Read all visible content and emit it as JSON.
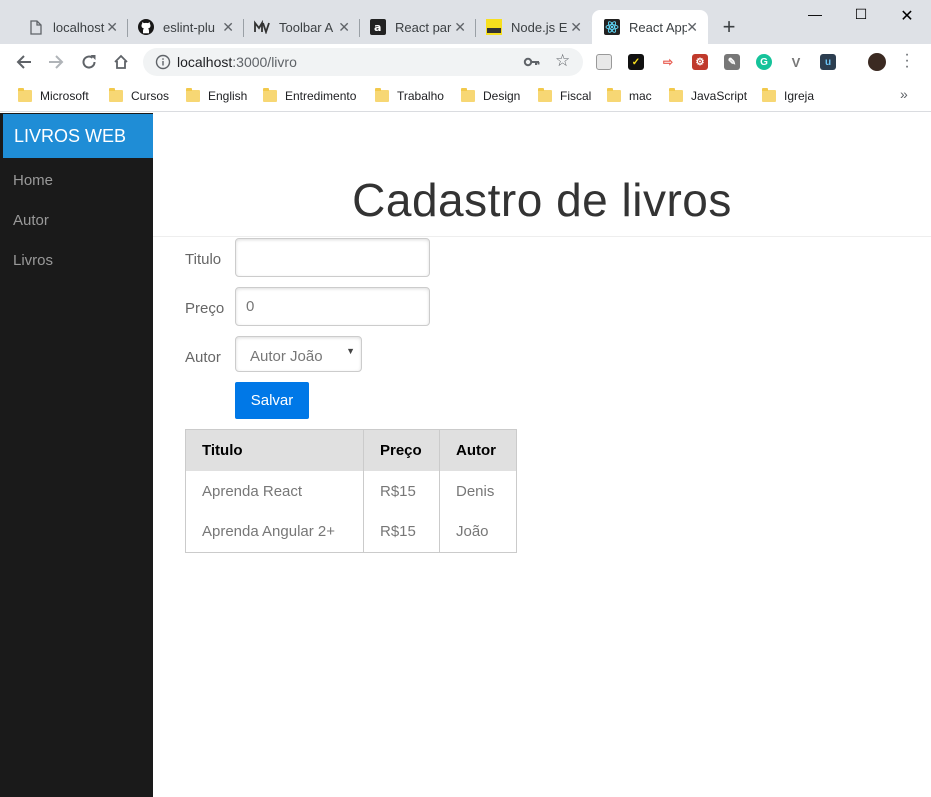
{
  "browser": {
    "tabs": [
      {
        "title": "localhost",
        "icon": "page-icon",
        "active": false
      },
      {
        "title": "eslint-plu",
        "icon": "github-icon",
        "active": false
      },
      {
        "title": "Toolbar A",
        "icon": "toolbar-icon",
        "active": false
      },
      {
        "title": "React par",
        "icon": "a-icon",
        "active": false
      },
      {
        "title": "Node.js E",
        "icon": "node-icon",
        "active": false
      },
      {
        "title": "React App",
        "icon": "react-icon",
        "active": true
      }
    ],
    "new_tab": "+",
    "address": {
      "host": "localhost",
      "path": ":3000/livro"
    },
    "bookmarks": [
      "Microsoft",
      "Cursos",
      "English",
      "Entredimento",
      "Trabalho",
      "Design",
      "Fiscal",
      "mac",
      "JavaScript",
      "Igreja"
    ],
    "bookmarks_more": "»",
    "colors": {
      "titlebar": "#dee1e6"
    }
  },
  "sidebar": {
    "brand": "LIVROS WEB",
    "items": [
      {
        "label": "Home"
      },
      {
        "label": "Autor"
      },
      {
        "label": "Livros"
      }
    ],
    "colors": {
      "background": "#1a1a1a",
      "brand": "#1f8dd6"
    }
  },
  "main": {
    "title": "Cadastro de livros",
    "form": {
      "titulo_label": "Titulo",
      "titulo_value": "",
      "preco_label": "Preço",
      "preco_value": "0",
      "autor_label": "Autor",
      "autor_selected": "Autor João",
      "submit_label": "Salvar"
    },
    "table": {
      "headers": [
        "Titulo",
        "Preço",
        "Autor"
      ],
      "rows": [
        [
          "Aprenda React",
          "R$15",
          "Denis"
        ],
        [
          "Aprenda Angular 2+",
          "R$15",
          "João"
        ]
      ]
    },
    "colors": {
      "button": "#0078e7"
    }
  }
}
